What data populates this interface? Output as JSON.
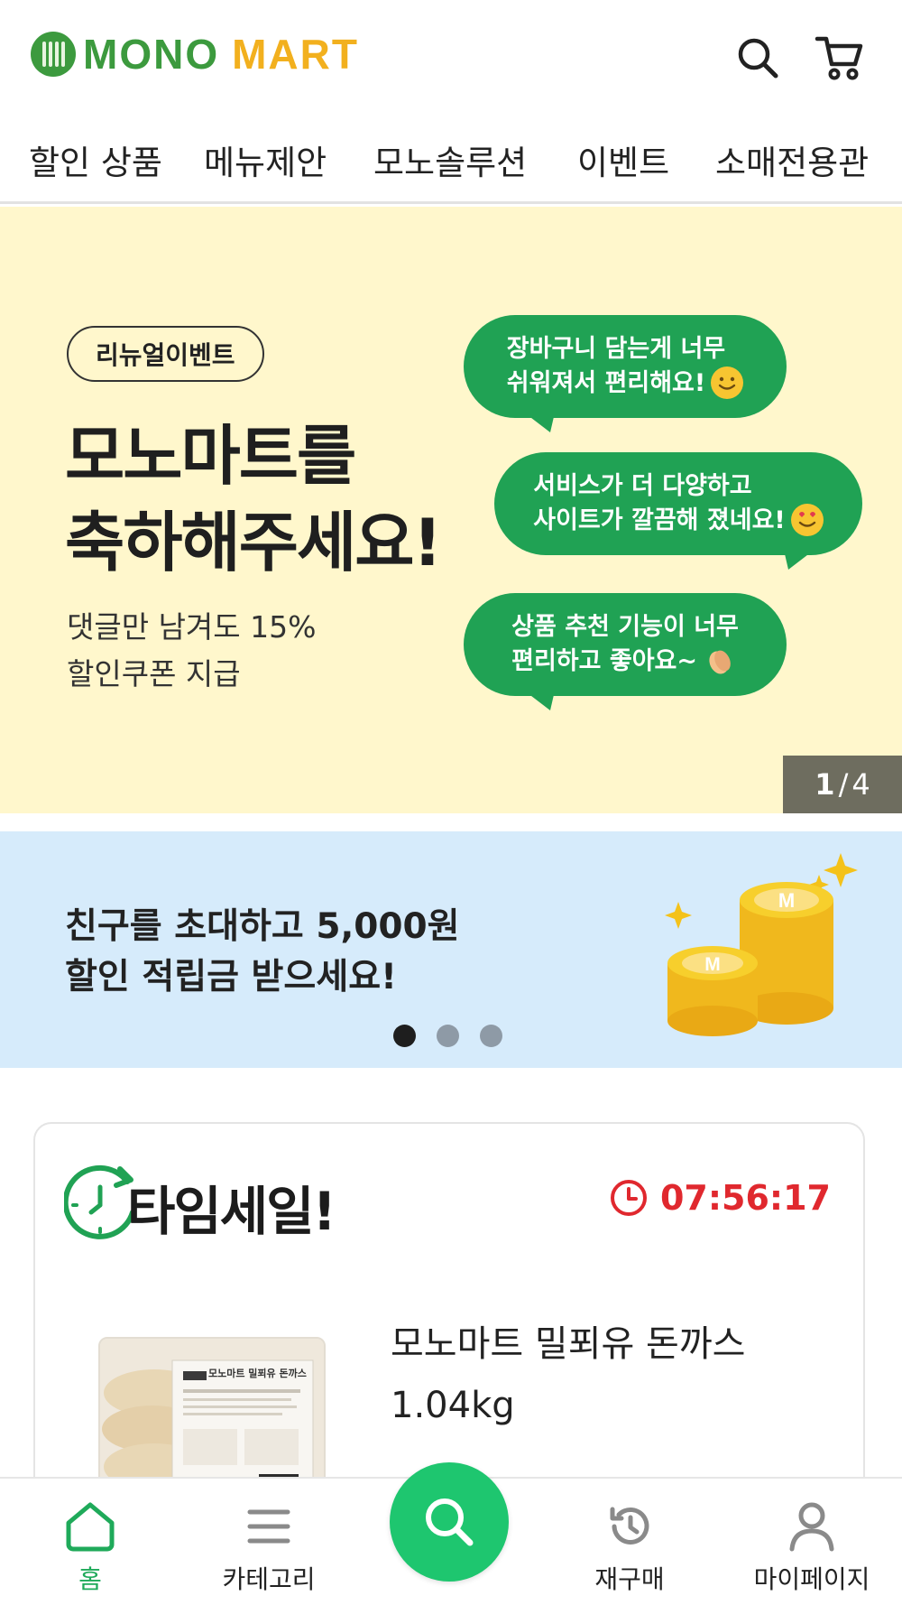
{
  "header": {
    "logo_mono": "MONO",
    "logo_mart": "MART",
    "search_icon": "search-icon",
    "cart_icon": "cart-icon"
  },
  "topnav": {
    "items": [
      "할인 상품",
      "메뉴제안",
      "모노솔루션",
      "이벤트",
      "소매전용관"
    ]
  },
  "main_banner": {
    "pill": "리뉴얼이벤트",
    "headline_line1": "모노마트를",
    "headline_line2": "축하해주세요!",
    "sub_line1": "댓글만 남겨도 15%",
    "sub_line2": "할인쿠폰 지급",
    "bubbles": [
      {
        "line1": "장바구니 담는게 너무",
        "line2": "쉬워져서 편리해요!"
      },
      {
        "line1": "서비스가 더 다양하고",
        "line2": "사이트가 깔끔해 졌네요!"
      },
      {
        "line1": "상품 추천 기능이 너무",
        "line2": "편리하고 좋아요~"
      }
    ],
    "counter_current": "1",
    "counter_sep": "/",
    "counter_total": "4"
  },
  "invite_banner": {
    "line1": "친구를 초대하고 5,000원",
    "line2": "할인 적립금 받으세요!",
    "dots_total": 3,
    "dots_active": 1
  },
  "time_sale": {
    "title": "타임세일!",
    "timer": "07:56:17",
    "product_name_line1": "모노마트 밀푀유 돈까스",
    "product_name_line2": "1.04kg",
    "product_label": "모노마트 밀푀유 돈까스"
  },
  "bottomnav": {
    "home": "홈",
    "category": "카테고리",
    "reorder": "재구매",
    "mypage": "마이페이지"
  },
  "colors": {
    "brand_green": "#3c9a3e",
    "brand_yellow": "#f2b01e",
    "bubble_green": "#20a254",
    "timer_red": "#e0282e",
    "search_fab": "#1ec66f"
  }
}
